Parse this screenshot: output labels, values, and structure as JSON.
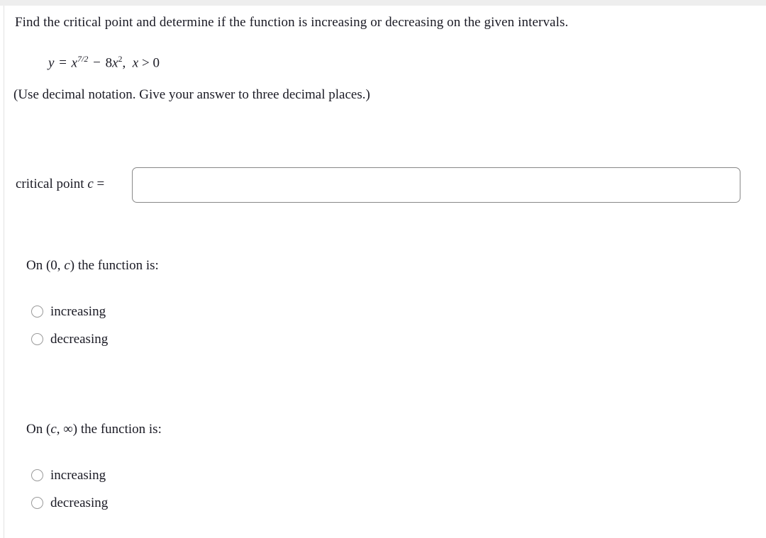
{
  "question": {
    "prompt": "Find the critical point and determine if the function is increasing or decreasing on the given intervals.",
    "formula": {
      "lhs": "y",
      "equals": "=",
      "base": "x",
      "exponent": "7/2",
      "minus": "−",
      "term2_coefficient": "8",
      "term2_base": "x",
      "term2_exponent": "2",
      "comma": ",",
      "domain_variable": "x",
      "domain_relation": ">",
      "domain_value": "0",
      "plain_text": "y = x^(7/2) − 8x²,  x > 0"
    },
    "note": "(Use decimal notation. Give your answer to three decimal places.)"
  },
  "critical_point": {
    "label_text": "critical point ",
    "label_var": "c",
    "label_equals": " =",
    "value": "",
    "placeholder": ""
  },
  "intervals": [
    {
      "title_prefix": "On (0, ",
      "title_var": "c",
      "title_suffix": ") the function is:",
      "title_plain": "On (0, c) the function is:",
      "options": [
        {
          "label": "increasing",
          "selected": false
        },
        {
          "label": "decreasing",
          "selected": false
        }
      ]
    },
    {
      "title_prefix": "On (",
      "title_var": "c",
      "title_suffix": ", ∞) the function is:",
      "title_plain": "On (c, ∞) the function is:",
      "options": [
        {
          "label": "increasing",
          "selected": false
        },
        {
          "label": "decreasing",
          "selected": false
        }
      ]
    }
  ],
  "colors": {
    "text": "#1a1a24",
    "input_border": "#888888",
    "radio_border": "#9a9a9a",
    "top_strip": "#eeeeee",
    "left_rule": "#e2e2e2",
    "background": "#ffffff"
  }
}
